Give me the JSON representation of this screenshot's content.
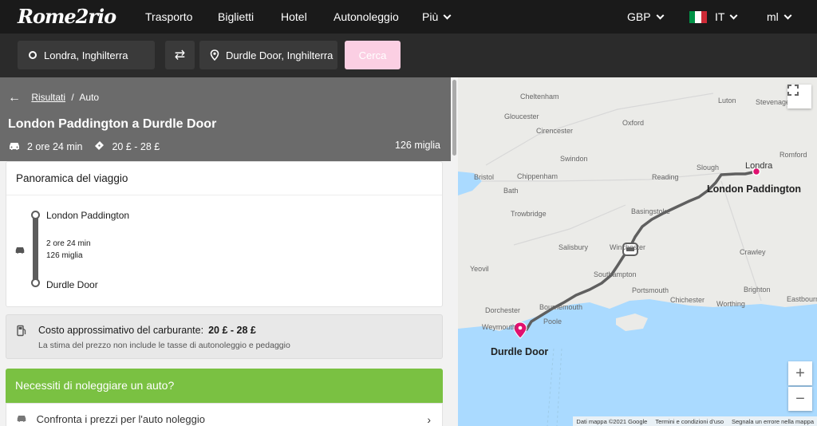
{
  "nav": {
    "logo": "Rome2rio",
    "links": [
      "Trasporto",
      "Biglietti",
      "Hotel",
      "Autonoleggio",
      "Più"
    ],
    "currency": "GBP",
    "language": "IT",
    "units": "ml"
  },
  "search": {
    "origin": "Londra, Inghilterra",
    "destination": "Durdle Door, Inghilterra",
    "button": "Cerca"
  },
  "breadcrumb": {
    "results": "Risultati",
    "separator": "/",
    "current": "Auto"
  },
  "route": {
    "title": "London Paddington a Durdle Door",
    "duration": "2 ore 24 min",
    "price": "20 £ - 28 £",
    "distance": "126 miglia"
  },
  "overview": {
    "title": "Panoramica del viaggio",
    "from": "London Paddington",
    "duration": "2 ore 24 min",
    "distance": "126 miglia",
    "to": "Durdle Door"
  },
  "fuel": {
    "label": "Costo approssimativo del carburante:",
    "value": "20 £ - 28 £",
    "note": "La stima del prezzo non include le tasse di autonoleggio e pedaggio"
  },
  "rental": {
    "heading": "Necessiti di noleggiare un auto?",
    "compare": "Confronta i prezzi per l'auto noleggio"
  },
  "map": {
    "towns": [
      {
        "name": "Cheltenham"
      },
      {
        "name": "Luton"
      },
      {
        "name": "Stevenage"
      },
      {
        "name": "Gloucester"
      },
      {
        "name": "Oxford"
      },
      {
        "name": "Cirencester"
      },
      {
        "name": "Swindon"
      },
      {
        "name": "Romford"
      },
      {
        "name": "Bristol"
      },
      {
        "name": "Chippenham"
      },
      {
        "name": "Reading"
      },
      {
        "name": "Slough"
      },
      {
        "name": "Bath"
      },
      {
        "name": "Londra"
      },
      {
        "name": "Trowbridge"
      },
      {
        "name": "Basingstoke"
      },
      {
        "name": "Salisbury"
      },
      {
        "name": "Winchester"
      },
      {
        "name": "Crawley"
      },
      {
        "name": "Yeovil"
      },
      {
        "name": "Southampton"
      },
      {
        "name": "Portsmouth"
      },
      {
        "name": "Chichester"
      },
      {
        "name": "Brighton"
      },
      {
        "name": "Worthing"
      },
      {
        "name": "Eastbourne"
      },
      {
        "name": "Dorchester"
      },
      {
        "name": "Bournemouth"
      },
      {
        "name": "Weymouth"
      },
      {
        "name": "Poole"
      }
    ],
    "origin_label": "London Paddington",
    "destination_label": "Durdle Door",
    "footer": {
      "data": "Dati mappa ©2021 Google",
      "terms": "Termini e condizioni d'uso",
      "report": "Segnala un errore nella mappa"
    },
    "route_color": "#5f5f5f",
    "pin_color": "#e0106f"
  },
  "colors": {
    "nav_bg": "#1a1a1a",
    "search_btn": "#fbcfe3",
    "hero_bg": "#6b6b6b",
    "rental_green": "#7ac142"
  }
}
